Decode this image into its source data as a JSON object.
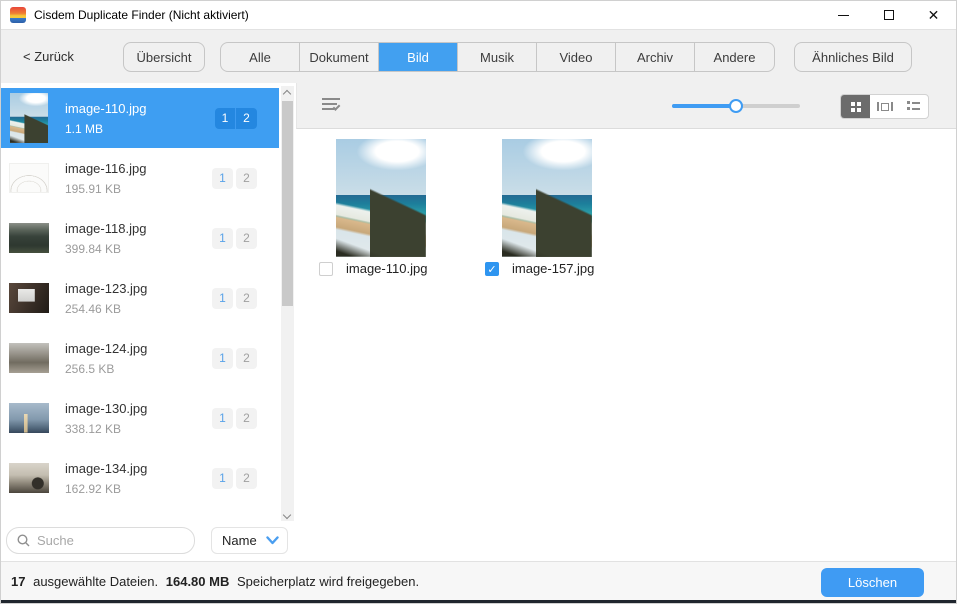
{
  "window": {
    "title": "Cisdem Duplicate Finder (Nicht aktiviert)"
  },
  "toolbar": {
    "back_label": "< Zurück",
    "overview_label": "Übersicht",
    "tabs": [
      "Alle",
      "Dokument",
      "Bild",
      "Musik",
      "Video",
      "Archiv",
      "Andere"
    ],
    "active_tab": "Bild",
    "similar_label": "Ähnliches Bild"
  },
  "sidebar": {
    "badge_labels": [
      "1",
      "2"
    ],
    "items": [
      {
        "name": "image-110.jpg",
        "size": "1.1 MB",
        "selected": true
      },
      {
        "name": "image-116.jpg",
        "size": "195.91 KB",
        "selected": false
      },
      {
        "name": "image-118.jpg",
        "size": "399.84 KB",
        "selected": false
      },
      {
        "name": "image-123.jpg",
        "size": "254.46 KB",
        "selected": false
      },
      {
        "name": "image-124.jpg",
        "size": "256.5 KB",
        "selected": false
      },
      {
        "name": "image-130.jpg",
        "size": "338.12 KB",
        "selected": false
      },
      {
        "name": "image-134.jpg",
        "size": "162.92 KB",
        "selected": false
      }
    ],
    "search_placeholder": "Suche",
    "sort_value": "Name"
  },
  "main": {
    "zoom_slider_percent": 50,
    "view_modes": [
      "grid",
      "coverflow",
      "list"
    ],
    "active_view_mode": "grid",
    "cards": [
      {
        "name": "image-110.jpg",
        "checked": false
      },
      {
        "name": "image-157.jpg",
        "checked": true,
        "checkmark": "✓"
      }
    ]
  },
  "statusbar": {
    "count": "17",
    "count_text": "ausgewählte Dateien.",
    "size": "164.80 MB",
    "size_text": "Speicherplatz wird freigegeben.",
    "delete_label": "Löschen"
  },
  "colors": {
    "accent": "#3f9bf3",
    "selected_row": "#3e9ef2",
    "active_tab": "#42a0f0",
    "badge_selected": "#2487e0"
  }
}
